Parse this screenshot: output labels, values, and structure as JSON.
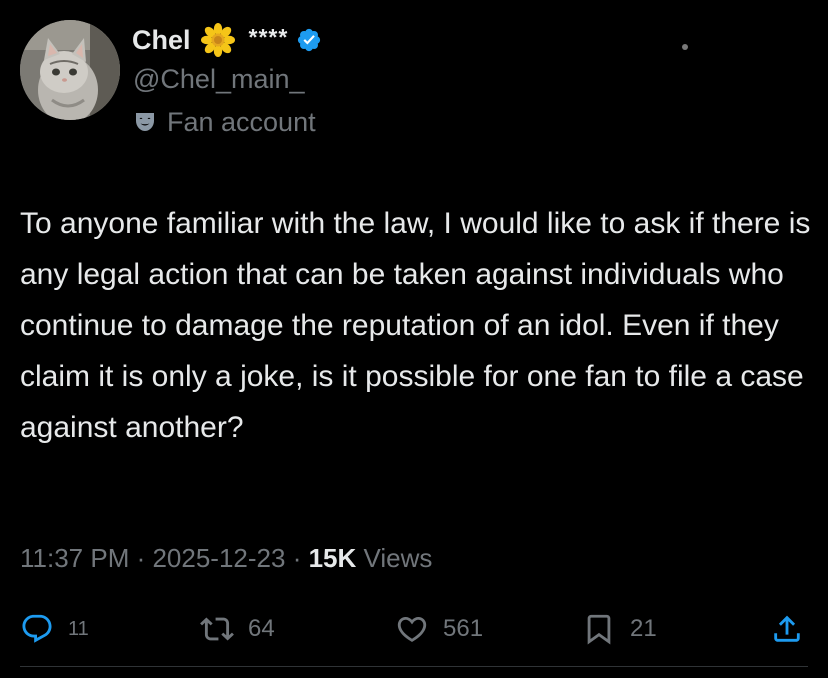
{
  "author": {
    "display_name": "Chel",
    "stars": "****",
    "handle": "@Chel_main_",
    "label": "Fan account"
  },
  "post": {
    "text": "To anyone familiar with the law, I would like to ask if there is any legal action that can be taken against individuals who continue to damage the reputation of an idol. Even if they claim it is only a joke, is it possible for one fan to file a case against another?",
    "time": "11:37 PM",
    "date": "2025-12-23",
    "views_count": "15K",
    "views_label": "Views"
  },
  "actions": {
    "replies": "11",
    "reposts": "64",
    "likes": "561",
    "bookmarks": "21"
  },
  "colors": {
    "background": "#000000",
    "text_primary": "#e7e9ea",
    "text_secondary": "#71767b",
    "verified_badge": "#1d9bf0"
  },
  "icons": [
    "flower-emoji-icon",
    "verified-badge-icon",
    "performing-arts-icon",
    "reply-icon",
    "repost-icon",
    "like-icon",
    "bookmark-icon",
    "share-icon"
  ]
}
